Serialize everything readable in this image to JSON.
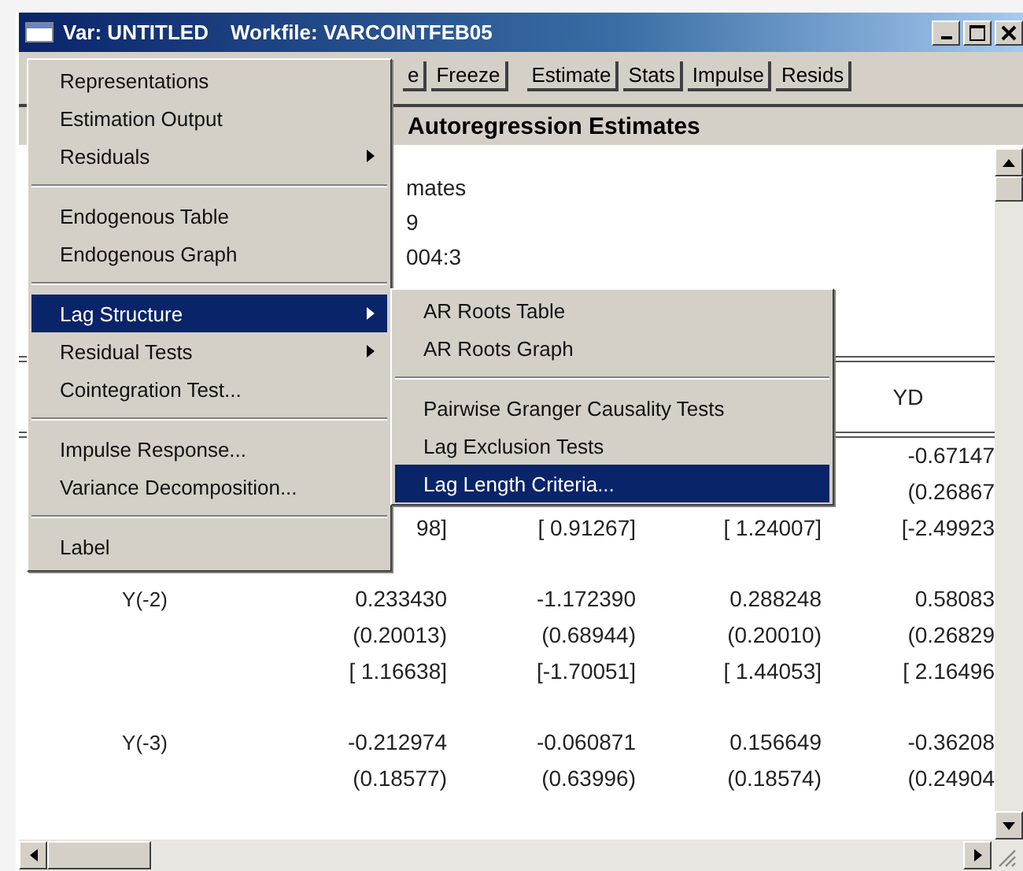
{
  "window": {
    "title": "Var: UNTITLED",
    "workfile": "Workfile: VARCOINTFEB05"
  },
  "toolbar": {
    "groups": [
      [
        "e",
        "Freeze"
      ],
      [
        "Estimate",
        "Stats",
        "Impulse",
        "Resids"
      ]
    ]
  },
  "header": "Autoregression Estimates",
  "body_lines": [
    "mates",
    "9",
    "004:3"
  ],
  "table": {
    "column_header": "YD",
    "rows": [
      {
        "lines": [
          {
            "column_4": "-0.67147"
          },
          {
            "column_4": "(0.26867"
          },
          {
            "column_1": "98]",
            "column_2": "[ 0.91267]",
            "column_3": "[ 1.24007]",
            "column_4": "[-2.49923"
          }
        ]
      },
      {
        "label": "Y(-2)",
        "lines": [
          {
            "column_1": "0.233430",
            "column_2": "-1.172390",
            "column_3": "0.288248",
            "column_4": "0.58083"
          },
          {
            "column_1": "(0.20013)",
            "column_2": "(0.68944)",
            "column_3": "(0.20010)",
            "column_4": "(0.26829"
          },
          {
            "column_1": "[ 1.16638]",
            "column_2": "[-1.70051]",
            "column_3": "[ 1.44053]",
            "column_4": "[ 2.16496"
          }
        ]
      },
      {
        "label": "Y(-3)",
        "lines": [
          {
            "column_1": "-0.212974",
            "column_2": "-0.060871",
            "column_3": "0.156649",
            "column_4": "-0.36208"
          },
          {
            "column_1": "(0.18577)",
            "column_2": "(0.63996)",
            "column_3": "(0.18574)",
            "column_4": "(0.24904"
          }
        ]
      }
    ]
  },
  "menu": [
    {
      "kind": "item",
      "label": "Representations",
      "submenu": false,
      "selected": false
    },
    {
      "kind": "item",
      "label": "Estimation Output",
      "submenu": false,
      "selected": false
    },
    {
      "kind": "item",
      "label": "Residuals",
      "submenu": true,
      "selected": false
    },
    {
      "kind": "separator"
    },
    {
      "kind": "item",
      "label": "Endogenous Table",
      "submenu": false,
      "selected": false
    },
    {
      "kind": "item",
      "label": "Endogenous Graph",
      "submenu": false,
      "selected": false
    },
    {
      "kind": "separator"
    },
    {
      "kind": "item",
      "label": "Lag Structure",
      "submenu": true,
      "selected": true
    },
    {
      "kind": "item",
      "label": "Residual Tests",
      "submenu": true,
      "selected": false
    },
    {
      "kind": "item",
      "label": "Cointegration Test...",
      "submenu": false,
      "selected": false
    },
    {
      "kind": "separator"
    },
    {
      "kind": "item",
      "label": "Impulse Response...",
      "submenu": false,
      "selected": false
    },
    {
      "kind": "item",
      "label": "Variance Decomposition...",
      "submenu": false,
      "selected": false
    },
    {
      "kind": "separator"
    },
    {
      "kind": "item",
      "label": "Label",
      "submenu": false,
      "selected": false
    }
  ],
  "submenu": [
    {
      "kind": "item",
      "label": "AR Roots Table",
      "selected": false
    },
    {
      "kind": "item",
      "label": "AR Roots Graph",
      "selected": false
    },
    {
      "kind": "separator"
    },
    {
      "kind": "item",
      "label": "Pairwise Granger Causality Tests",
      "selected": false
    },
    {
      "kind": "item",
      "label": "Lag Exclusion Tests",
      "selected": false
    },
    {
      "kind": "item",
      "label": "Lag Length Criteria...",
      "selected": true
    }
  ]
}
